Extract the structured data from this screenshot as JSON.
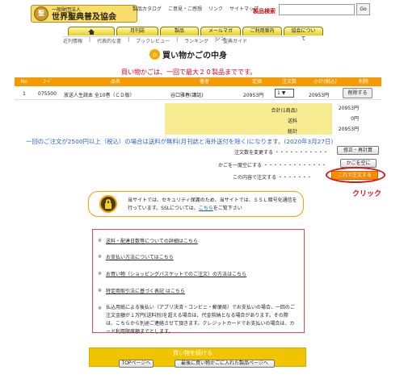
{
  "header": {
    "logo": {
      "small": "一般財団法人",
      "main": "世界聖典普及協会"
    },
    "top_links": [
      "製品カタログ",
      "ご意見・ご感想",
      "リンク",
      "サイトマップ"
    ],
    "search_label": "製品検索",
    "search_value": "",
    "go_label": "Go"
  },
  "nav": {
    "tabs": [
      "月刊誌",
      "製品",
      "メールマガジン",
      "ご利用案内",
      "協会について"
    ],
    "subnav": [
      "近刊情報",
      "代表的な書",
      "ブックレビュー",
      "ランキング",
      "聖典ガイド"
    ]
  },
  "page": {
    "title": "買い物かごの中身",
    "limit_note": "買い物かごは、一回で最大２０製品までです。",
    "table": {
      "headers": [
        "No",
        "ｺｰﾄﾞ",
        "品名",
        "著者",
        "定価",
        "注文数",
        "小計(税込)",
        "削除"
      ],
      "rows": [
        {
          "no": "1",
          "code": "075500",
          "name": "放送人生読本 全10巻（ＣＤ版）",
          "author": "谷口雅春(講話)",
          "price": "20953円",
          "qty": "1",
          "subtotal": "20953円",
          "delete": "削除する"
        }
      ]
    },
    "summary": [
      {
        "label": "合計(1商品)",
        "value": "20953円"
      },
      {
        "label": "送料",
        "value": "0円"
      },
      {
        "label": "総計",
        "value": "20953円"
      }
    ],
    "shipping_note": "一回のご注文が2500円以上（税込）の場合は送料が無料(月刊誌と海外送付を除く)になります。(2020年3月27日)",
    "actions": [
      {
        "text": "注文数を変更する ・・・・・・・・・・・",
        "button": "修正・再計算"
      },
      {
        "text": "かごを一度空にする ・・・・・・・・・・・・・",
        "button": "かごを空に"
      },
      {
        "text": "この内容で注文する ・・・・・・・",
        "button": "これで注文する"
      }
    ],
    "click_annotation": "クリック",
    "ssl": {
      "line1": "当サイトでは、ＳＳＬ暗号化通信を",
      "line1_prefix": "当サイトでは、セキュリティ保護のため、",
      "line2_prefix": "行っています。SSLについては、",
      "link": "こちら",
      "line2_suffix": "をご覧下さい"
    },
    "info_items": [
      "送料・配達日数等についての詳細はこちら",
      "お支払い方法についてはこちら",
      "お買い物（ショッピングバスケットでのご注文）の方法はこちら",
      "特定商取引法に基づく表記 はこちら",
      "払込用紙による後払い（アプリ決済・コンビニ・郵便局）でお支払いの場合、一回のご注文金額が１万円(送料別)を超える場合は、代金前納となる場合があります。その際は、こちらから別途ご連絡させて頂きます。クレジットカードでお支払いの場合は、カード利用限度額までとします。"
    ],
    "continue": {
      "title": "買い物を続ける",
      "top_button": "TOPページへ",
      "cart_button": "最後に買い物かごに入れた製品ページへ"
    }
  },
  "colors": {
    "orange": "#f59a00",
    "red": "#e0001b",
    "blue": "#2f5fd0",
    "yellow": "#f8ec93"
  }
}
